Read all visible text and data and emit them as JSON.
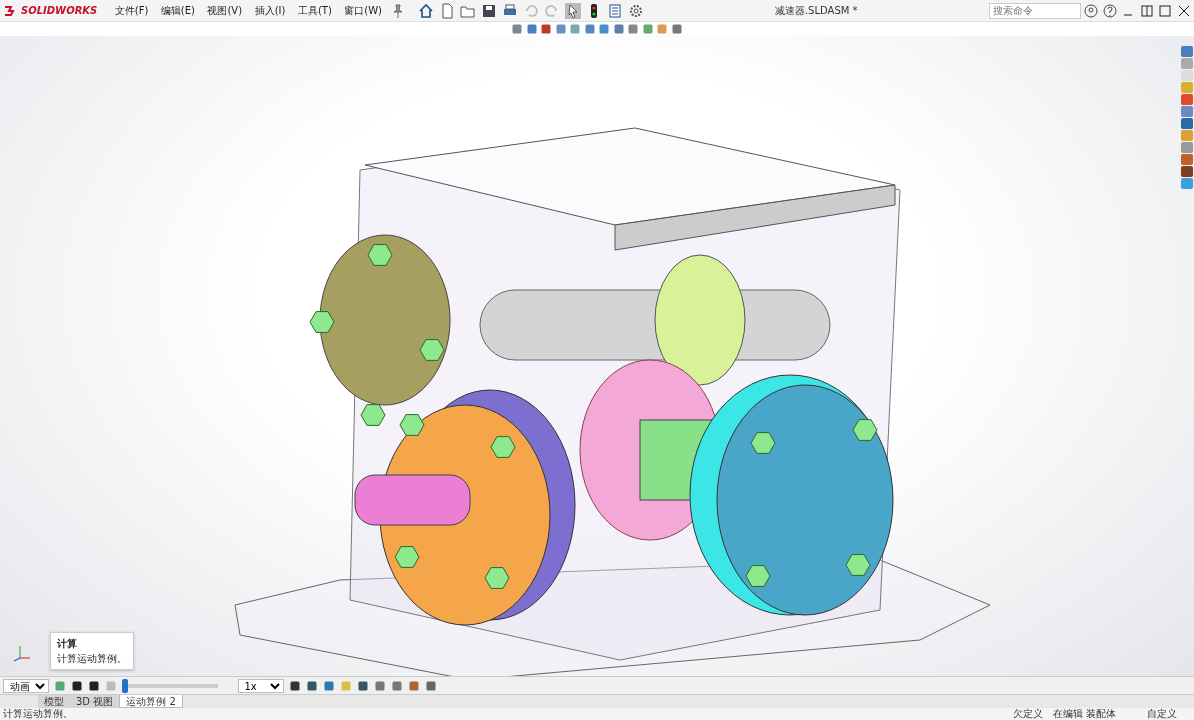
{
  "app": {
    "logo": "SOLIDWORKS"
  },
  "menus": [
    "文件(F)",
    "编辑(E)",
    "视图(V)",
    "插入(I)",
    "工具(T)",
    "窗口(W)"
  ],
  "window": {
    "title": "减速器.SLDASM *"
  },
  "search": {
    "placeholder": "搜索命令"
  },
  "tooltip": {
    "title": "计算",
    "text": "计算运动算例。"
  },
  "motion": {
    "study_type": "动画",
    "speed": "1x",
    "level": 0.0
  },
  "tabs": [
    {
      "label": "模型",
      "selected": false
    },
    {
      "label": "3D 视图",
      "selected": false
    },
    {
      "label": "运动算例 2",
      "selected": true
    }
  ],
  "status_bar": {
    "message": "计算运动算例。",
    "items": [
      "欠定义",
      "在编辑 装配体",
      "自定义"
    ]
  }
}
